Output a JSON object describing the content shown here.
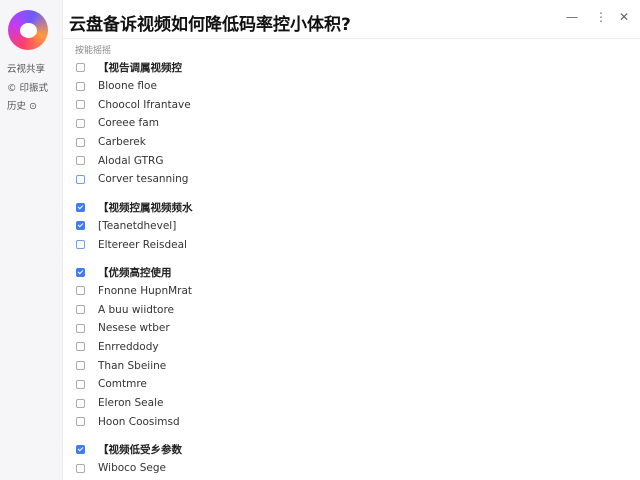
{
  "window": {
    "title": "云盘备诉视频如何降低码率控小体积?",
    "minimize_glyph": "—",
    "more_glyph": "⋮",
    "close_glyph": "✕"
  },
  "sidebar": {
    "items": [
      {
        "label": "云视共享"
      },
      {
        "label": "© 印振式"
      },
      {
        "label": "历史 ⊙"
      }
    ]
  },
  "section_label": "按能摇摇",
  "groups": [
    {
      "header": {
        "label": "【视告调属视频控",
        "checkbox": "empty"
      },
      "items": [
        {
          "label": "Bloone floe",
          "checkbox": "empty"
        },
        {
          "label": "Choocol Ifrantave",
          "checkbox": "empty"
        },
        {
          "label": "Coreee fam",
          "checkbox": "empty"
        },
        {
          "label": "Carberek",
          "checkbox": "empty"
        },
        {
          "label": "Alodal GTRG",
          "checkbox": "empty"
        },
        {
          "label": "Corver tesanning",
          "checkbox": "blue-outline"
        }
      ]
    },
    {
      "header": {
        "label": "【视频控属视频频水",
        "checkbox": "checked"
      },
      "items": [
        {
          "label": "[Teanetdhevel]",
          "checkbox": "checked"
        },
        {
          "label": "Eltereer Reisdeal",
          "checkbox": "blue-outline"
        }
      ]
    },
    {
      "header": {
        "label": "【优频高控使用",
        "checkbox": "checked"
      },
      "items": [
        {
          "label": "Fnonne HupnMrat",
          "checkbox": "empty"
        },
        {
          "label": "A buu wiidtore",
          "checkbox": "empty"
        },
        {
          "label": "Nesese wtber",
          "checkbox": "empty"
        },
        {
          "label": "Enrreddody",
          "checkbox": "empty"
        },
        {
          "label": "Than Sbeiine",
          "checkbox": "empty"
        },
        {
          "label": "Comtmre",
          "checkbox": "empty"
        },
        {
          "label": "Eleron Seale",
          "checkbox": "empty"
        },
        {
          "label": "Hoon Coosimsd",
          "checkbox": "empty"
        }
      ]
    },
    {
      "header": {
        "label": "【视频低受乡参数",
        "checkbox": "checked"
      },
      "items": [
        {
          "label": "Wiboco Sege",
          "checkbox": "empty"
        }
      ]
    }
  ]
}
